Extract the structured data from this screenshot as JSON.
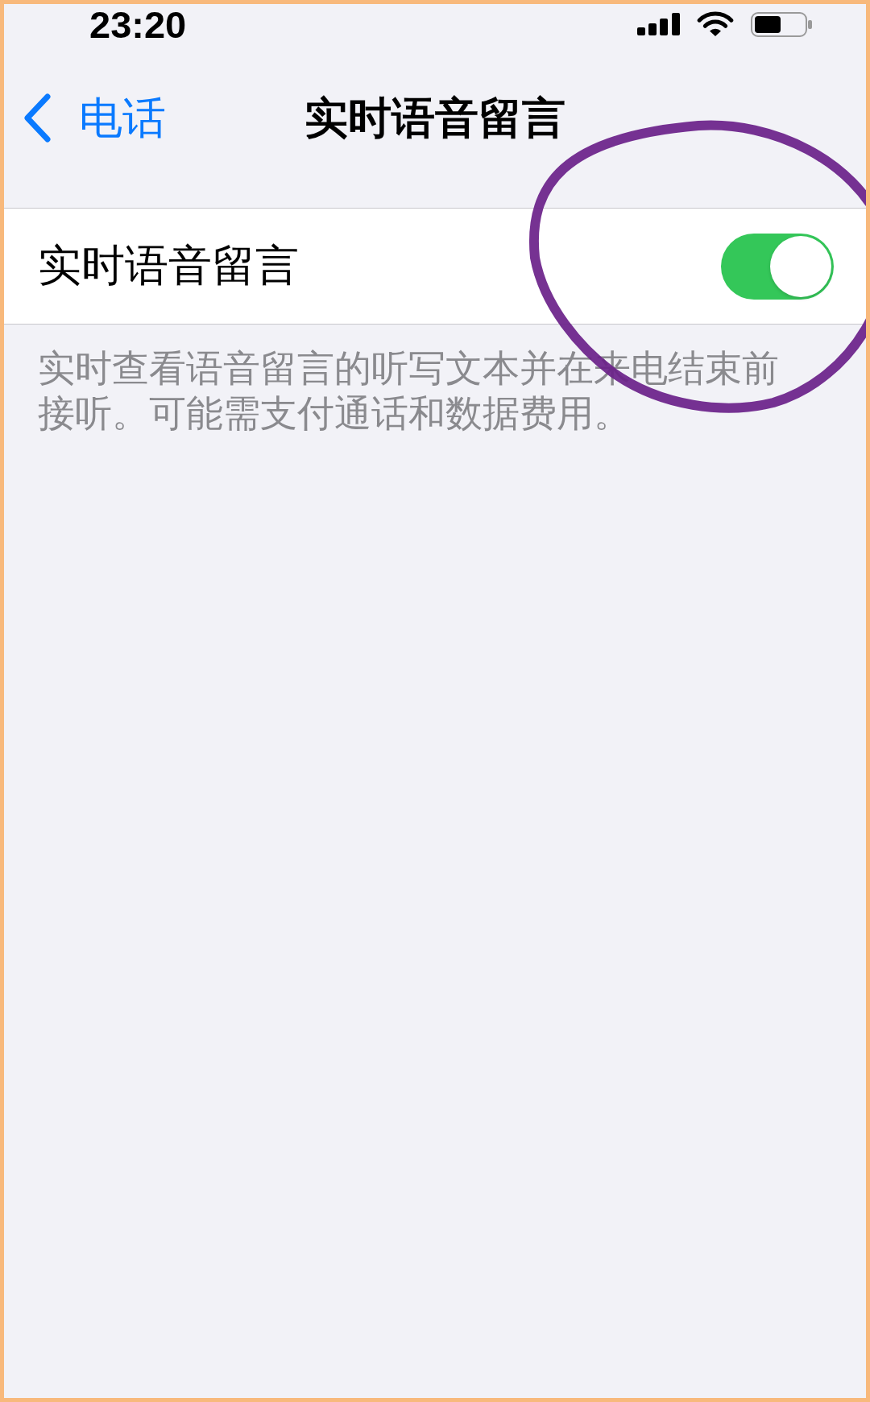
{
  "status_bar": {
    "time": "23:20"
  },
  "nav_bar": {
    "back_label": "电话",
    "title": "实时语音留言"
  },
  "settings": [
    {
      "label": "实时语音留言",
      "on": true
    }
  ],
  "footer": "实时查看语音留言的听写文本并在来电结束前接听。可能需支付通话和数据费用。"
}
